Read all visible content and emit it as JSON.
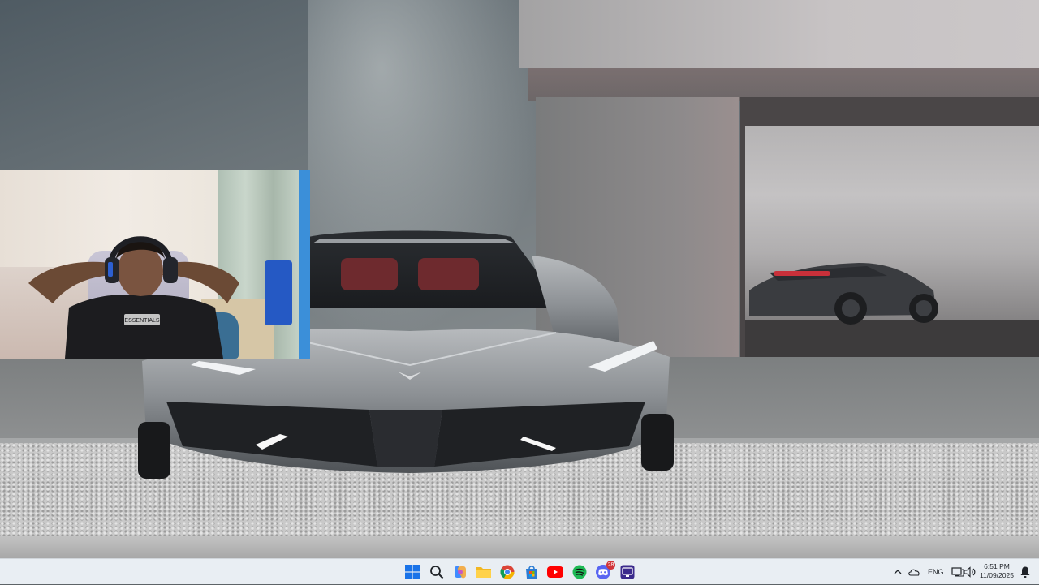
{
  "desktop": {
    "wallpaper_icon": "sports-car-wallpaper",
    "colors": {
      "sky": "#6f767a",
      "gravel": "#c9c9c9",
      "car": "#8f9396",
      "taillight": "#c8303a"
    }
  },
  "webcam": {
    "icon": "webcam-feed",
    "shirt_print": "ESSENTIALS"
  },
  "taskbar": {
    "background": "#e9eef3",
    "pinned": [
      {
        "name": "start",
        "icon": "windows-logo-icon"
      },
      {
        "name": "search",
        "icon": "search-icon"
      },
      {
        "name": "copilot",
        "icon": "copilot-icon"
      },
      {
        "name": "file-explorer",
        "icon": "folder-icon"
      },
      {
        "name": "chrome",
        "icon": "chrome-icon"
      },
      {
        "name": "microsoft-store",
        "icon": "store-icon"
      },
      {
        "name": "youtube",
        "icon": "youtube-icon"
      },
      {
        "name": "spotify",
        "icon": "spotify-icon"
      },
      {
        "name": "discord",
        "icon": "discord-icon",
        "badge": "28"
      },
      {
        "name": "obs-like-app",
        "icon": "recording-app-icon"
      }
    ],
    "tray": {
      "overflow_icon": "chevron-up-icon",
      "cloud_icon": "onedrive-icon",
      "language": "ENG",
      "network_icon": "network-icon",
      "volume_icon": "volume-icon",
      "time": "6:51 PM",
      "date": "11/09/2025",
      "notification_icon": "notification-icon"
    }
  }
}
